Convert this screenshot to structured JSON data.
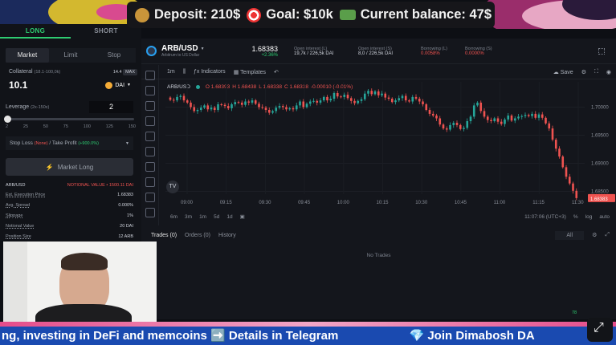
{
  "banner": {
    "deposit": "Deposit: 210$",
    "goal": "Goal: $10k",
    "balance": "Current balance: 47$",
    "icons": [
      "money-bag-icon",
      "target-icon",
      "money-wings-icon"
    ]
  },
  "trade_panel": {
    "tabs": [
      "LONG",
      "SHORT"
    ],
    "order_types": [
      "Market",
      "Limit",
      "Stop"
    ],
    "collateral_label": "Collateral",
    "collateral_range": "(18.1-100,0k)",
    "collateral_balance": "14.4",
    "max_label": "MAX",
    "collateral_value": "10.1",
    "token": "DAI",
    "leverage_label": "Leverage",
    "leverage_range": "(2x-150x)",
    "leverage_value": "2",
    "leverage_ticks": [
      "2",
      "25",
      "50",
      "75",
      "100",
      "125",
      "150"
    ],
    "stop_loss": "Stop Loss",
    "stop_loss_val": "(None)",
    "take_profit": "Take Profit",
    "take_profit_val": "(+900.0%)",
    "market_long_button": "Market Long",
    "pair": "ARB/USD",
    "notional_label": "NOTIONAL VALUE",
    "notional_value": "1500.11 DAI",
    "details": [
      {
        "k": "Est. Execution Price",
        "v": "1.68383"
      },
      {
        "k": "Avg. Spread",
        "v": "0.000%"
      },
      {
        "k": "Slippage",
        "v": "1%"
      },
      {
        "k": "Notional Value",
        "v": "20 DAI"
      },
      {
        "k": "Position Size",
        "v": "12 ARB"
      }
    ]
  },
  "chart_header": {
    "pair": "ARB/USD",
    "pair_sub": "Arbitrum to US Dollar",
    "price": "1.68383",
    "change": "+2.36%",
    "open_interest_long_label": "Open interest (L)",
    "open_interest_long": "19,7k / 226,5k DAI",
    "open_interest_short_label": "Open interest (S)",
    "open_interest_short": "8,0 / 226,5k DAI",
    "borrow_long_label": "Borrowing (L)",
    "borrow_long": "0.0058%",
    "borrow_short_label": "Borrowing (S)",
    "borrow_short": "0.0000%"
  },
  "chart_toolbar": {
    "interval": "1m",
    "indicators": "Indicators",
    "templates": "Templates",
    "save": "Save"
  },
  "ohlc": {
    "symbol": "ARB/USD",
    "o": "O 1.68393",
    "h": "H 1.68438",
    "l": "L 1.68338",
    "c": "C 1.68338",
    "chg": "-0.00010 (-0.01%)"
  },
  "chart_data": {
    "type": "candlestick",
    "x_ticks": [
      "09:00",
      "09:15",
      "09:30",
      "09:45",
      "10:00",
      "10:15",
      "10:30",
      "10:45",
      "11:00",
      "11:15",
      "11:30"
    ],
    "y_ticks": [
      "1.70000",
      "1.69500",
      "1.69000",
      "1.68500"
    ],
    "ylim": [
      1.6845,
      1.7045
    ],
    "closes": [
      1.7013,
      1.7012,
      1.7018,
      1.702,
      1.7012,
      1.7008,
      1.7,
      1.6993,
      1.6995,
      1.6999,
      1.7003,
      1.6996,
      1.6999,
      1.6995,
      1.7005,
      1.7004,
      1.7002,
      1.6998,
      1.7005,
      1.7009,
      1.7008,
      1.7004,
      1.701,
      1.7008,
      1.7012,
      1.7006,
      1.7,
      1.6999,
      1.6995,
      1.699,
      1.6993,
      1.6999,
      1.7002,
      1.7,
      1.6996,
      1.6998,
      1.6996,
      1.7003,
      1.701,
      1.7,
      1.7006,
      1.701,
      1.7011,
      1.7008,
      1.7012,
      1.7018,
      1.7012,
      1.7015,
      1.7025,
      1.7019,
      1.7018,
      1.7022,
      1.7016,
      1.7011,
      1.7007,
      1.7011,
      1.7014,
      1.7024,
      1.7029,
      1.7023,
      1.7028,
      1.7021,
      1.7024,
      1.7017,
      1.7015,
      1.7009,
      1.7012,
      1.7016,
      1.702,
      1.7012,
      1.701,
      1.7018,
      1.7015,
      1.701,
      1.7005,
      1.6995,
      1.6988,
      1.6985,
      1.698,
      1.6969,
      1.6962,
      1.696,
      1.6968,
      1.6972,
      1.6968,
      1.6961,
      1.6963,
      1.6975,
      1.6983,
      1.7003,
      1.7008,
      1.6993,
      1.6983,
      1.6977,
      1.6975,
      1.698,
      1.6974,
      1.697,
      1.6978,
      1.6985,
      1.6976,
      1.698,
      1.6983,
      1.6984,
      1.6986,
      1.6984,
      1.6988,
      1.6981,
      1.6987,
      1.6981,
      1.6971,
      1.6962,
      1.6942,
      1.6926,
      1.6912,
      1.6893,
      1.6876,
      1.6864,
      1.6851,
      1.6838
    ]
  },
  "time_controls": {
    "ranges": [
      "6m",
      "3m",
      "1m",
      "5d",
      "1d"
    ],
    "clock": "11:07:06 (UTC+3)",
    "pct": "%",
    "log": "log",
    "auto": "auto"
  },
  "bottom_tabs": {
    "trades": "Trades",
    "trades_count": "(0)",
    "orders": "Orders",
    "orders_count": "(0)",
    "history": "History",
    "filter": "All",
    "empty": "No Trades"
  },
  "ticker": {
    "text": "ng, investing in DeFi and memcoins ➡️ Details in Telegram",
    "text2": "💎 Join Dimabosh DA"
  },
  "footer_num": "78",
  "colors": {
    "up": "#26a69a",
    "down": "#ef5350",
    "accent": "#2ecc71"
  }
}
